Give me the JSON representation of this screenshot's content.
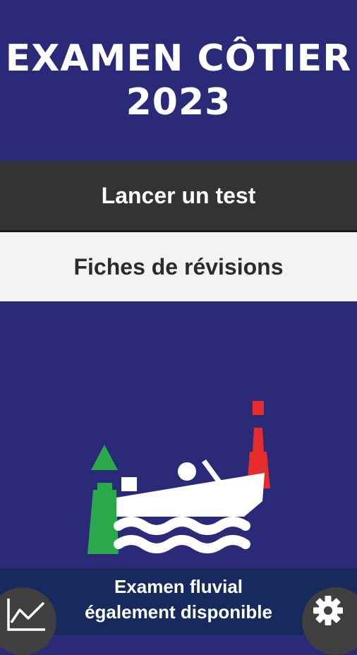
{
  "header": {
    "title_line1": "EXAMEN CÔTIER",
    "title_line2": "2023"
  },
  "menu": {
    "test_label": "Lancer un test",
    "revision_label": "Fiches de révisions"
  },
  "footer": {
    "promo_line1": "Examen fluvial",
    "promo_line2": "également disponible",
    "stats_icon": "line-chart-icon",
    "settings_icon": "gear-icon"
  },
  "colors": {
    "background": "#2a2a78",
    "buoy_green": "#2ba84a",
    "buoy_red": "#e52b2b",
    "boat": "#ffffff"
  }
}
